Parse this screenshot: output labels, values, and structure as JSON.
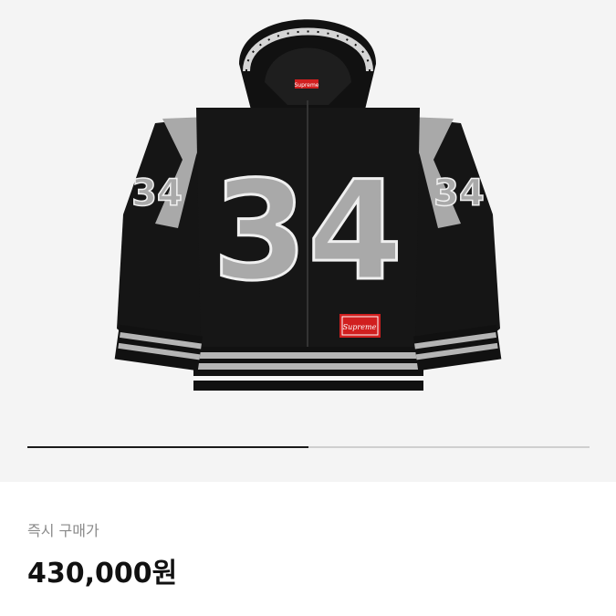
{
  "product": {
    "image_alt": "Supreme 34 hooded football jacket, black and grey",
    "jersey_number": "34",
    "brand_tag": "Supreme",
    "gallery_progress": 0.5
  },
  "purchase": {
    "label": "즉시 구매가",
    "price": "430,000원"
  }
}
